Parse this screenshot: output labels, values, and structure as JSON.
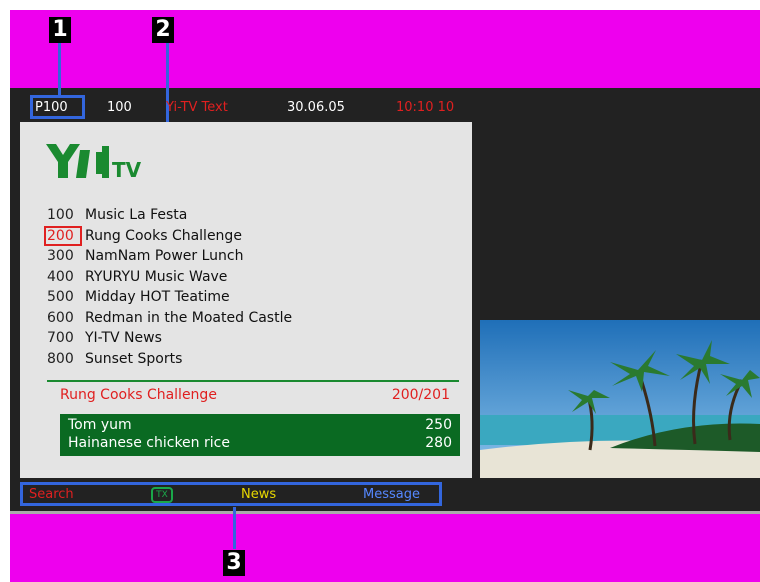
{
  "callouts": [
    "1",
    "2",
    "3"
  ],
  "status_bar": {
    "page": "P100",
    "number": "100",
    "service": "Yi-TV Text",
    "date": "30.06.05",
    "time": "10:10 10"
  },
  "logo": {
    "name": "Yi-TV logo",
    "color": "#1a8a30"
  },
  "index": [
    {
      "num": "100",
      "title": "Music La Festa"
    },
    {
      "num": "200",
      "title": "Rung Cooks Challenge",
      "selected": true
    },
    {
      "num": "300",
      "title": "NamNam Power Lunch"
    },
    {
      "num": "400",
      "title": "RYURYU Music Wave"
    },
    {
      "num": "500",
      "title": "Midday HOT Teatime"
    },
    {
      "num": "600",
      "title": "Redman in the Moated Castle"
    },
    {
      "num": "700",
      "title": "YI-TV News"
    },
    {
      "num": "800",
      "title": "Sunset Sports"
    }
  ],
  "program": {
    "title": "Rung Cooks Challenge",
    "pages": "200/201",
    "items": [
      {
        "name": "Tom yum",
        "page": "250"
      },
      {
        "name": "Hainanese chicken rice",
        "page": "280"
      }
    ]
  },
  "navbar": {
    "search": "Search",
    "icon": "teletext-icon",
    "news": "News",
    "message": "Message"
  },
  "colors": {
    "frame": "#ee00ee",
    "screen": "#222222",
    "highlight": "#3366dd",
    "red": "#e02020",
    "green": "#0a6a22",
    "yellow": "#e8d800",
    "blue": "#5588ff"
  }
}
